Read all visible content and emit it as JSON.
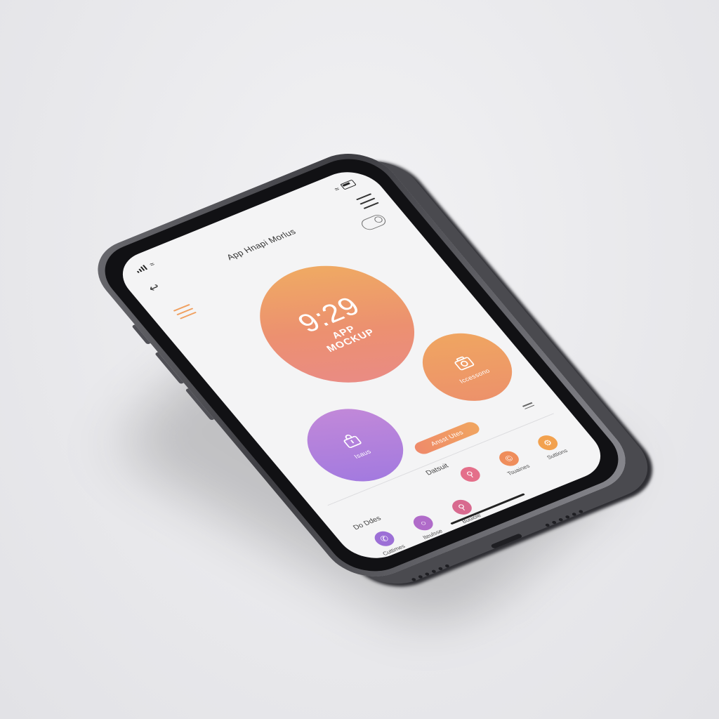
{
  "status_bar": {
    "icons": [
      "signal-icon",
      "wifi-icon",
      "battery-icon"
    ]
  },
  "header": {
    "title": "App Hnapi Morlus",
    "back_icon": "back-arrow-icon",
    "menu_icon": "hamburger-menu-icon"
  },
  "hero": {
    "time": "9:29",
    "subtitle_line1": "APP",
    "subtitle_line2": "MOCKUP"
  },
  "cards": {
    "camera": {
      "label": "Iccessono",
      "icon": "camera-icon"
    },
    "bag": {
      "label": "Isaus",
      "icon": "bag-icon"
    }
  },
  "pill_button": {
    "label": "Ansst Utes"
  },
  "section": {
    "label": "Datsuit",
    "row_label": "Do Ddes"
  },
  "top_row": [
    {
      "label": "",
      "icon": "search-icon",
      "color": "#e46f8a"
    },
    {
      "label": "Tsuaines",
      "icon": "coin-icon",
      "color": "#ef8d5b"
    },
    {
      "label": "Suttions",
      "icon": "settings-icon",
      "color": "#f2a14e"
    }
  ],
  "bottom_row": [
    {
      "label": "Cuttimes",
      "icon": "phone-icon",
      "color": "#9c6fd6"
    },
    {
      "label": "Iteulsse",
      "icon": "chat-icon",
      "color": "#b06bc9"
    },
    {
      "label": "Buuiole",
      "icon": "search-icon",
      "color": "#d86a8f"
    }
  ],
  "colors": {
    "accent_orange": "#f0a060",
    "accent_purple": "#9f78e0",
    "screen_bg": "#f4f4f5"
  }
}
